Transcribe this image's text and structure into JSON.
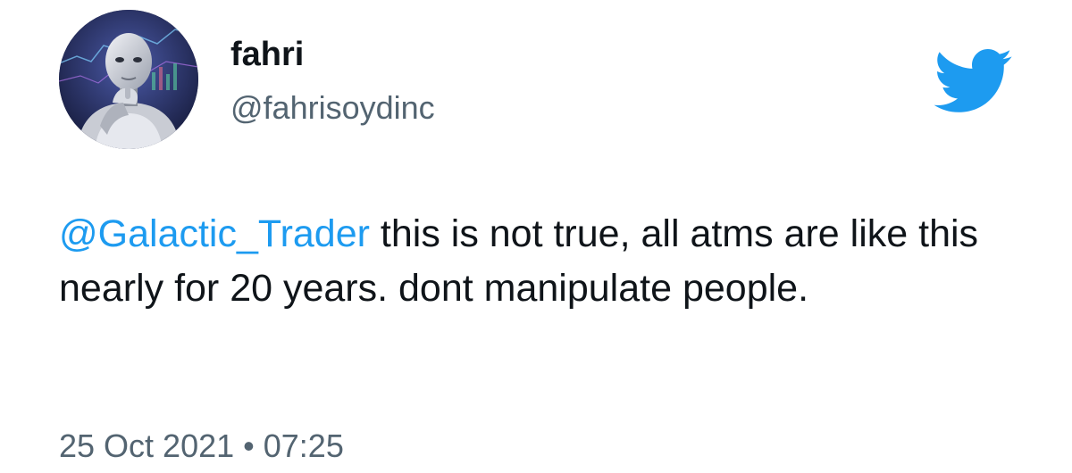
{
  "author": {
    "display_name": "fahri",
    "handle": "@fahrisoydinc",
    "avatar": "robot-thinking-avatar"
  },
  "tweet": {
    "mention": "@Galactic_Trader",
    "text": " this is not true, all atms are like this nearly for 20 years. dont manipulate people."
  },
  "timestamp": {
    "date": "25 Oct 2021",
    "separator": "•",
    "time": "07:25"
  },
  "icons": {
    "brand": "twitter-bird-icon"
  },
  "colors": {
    "brand_blue": "#1d9bf0",
    "text": "#0f1419",
    "secondary_text": "#536471",
    "background": "#ffffff"
  }
}
